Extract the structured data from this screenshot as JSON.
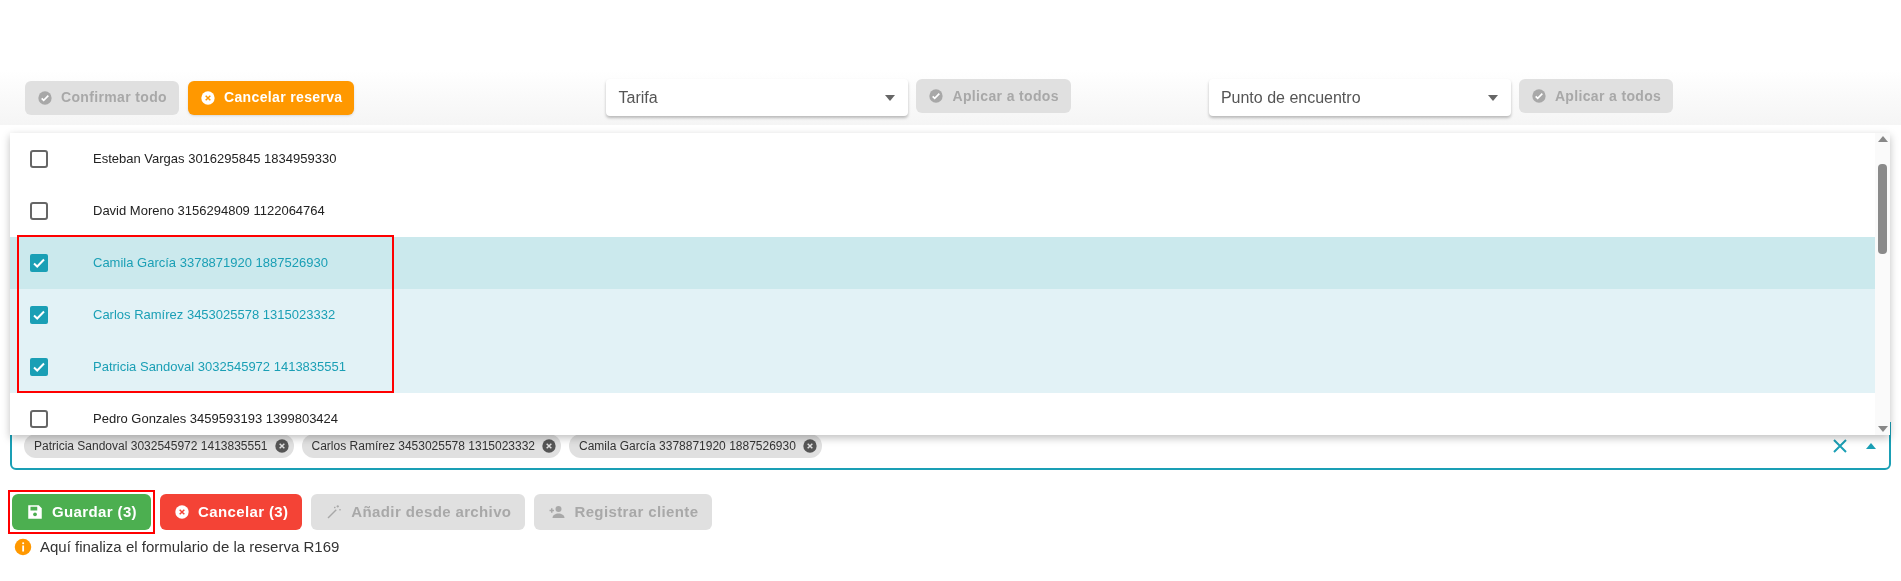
{
  "toolbar": {
    "buttons": [
      {
        "label": "Confirmar todo",
        "kind": "neutral",
        "disabled": true
      },
      {
        "label": "Cancelar reserva",
        "kind": "warning",
        "disabled": false
      }
    ],
    "tarifa": {
      "placeholder": "Tarifa",
      "apply": {
        "label": "Aplicar a todos",
        "disabled": true
      }
    },
    "punto": {
      "placeholder": "Punto de encuentro",
      "apply": {
        "label": "Aplicar a todos",
        "disabled": true
      }
    }
  },
  "options": [
    {
      "label": "Esteban Vargas 3016295845 1834959330",
      "checked": false,
      "focused": false,
      "highlighted": false
    },
    {
      "label": "David Moreno 3156294809 1122064764",
      "checked": false,
      "focused": false,
      "highlighted": false
    },
    {
      "label": "Camila García 3378871920 1887526930",
      "checked": true,
      "focused": true,
      "highlighted": true
    },
    {
      "label": "Carlos Ramírez 3453025578 1315023332",
      "checked": true,
      "focused": false,
      "highlighted": true
    },
    {
      "label": "Patricia Sandoval 3032545972 1413835551",
      "checked": true,
      "focused": false,
      "highlighted": true
    },
    {
      "label": "Pedro Gonzales 3459593193 1399803424",
      "checked": false,
      "focused": false,
      "highlighted": false
    }
  ],
  "chips": [
    "Patricia Sandoval 3032545972 1413835551",
    "Carlos Ramírez 3453025578 1315023332",
    "Camila García 3378871920 1887526930"
  ],
  "actions": [
    {
      "label": "Guardar (3)",
      "kind": "save",
      "disabled": false,
      "highlighted": true
    },
    {
      "label": "Cancelar (3)",
      "kind": "cancel",
      "disabled": false,
      "highlighted": false
    },
    {
      "label": "Añadir desde archivo",
      "kind": "import",
      "disabled": true,
      "highlighted": false
    },
    {
      "label": "Registrar cliente",
      "kind": "register",
      "disabled": true,
      "highlighted": false
    }
  ],
  "info": "Aquí finaliza el formulario de la reserva R169"
}
